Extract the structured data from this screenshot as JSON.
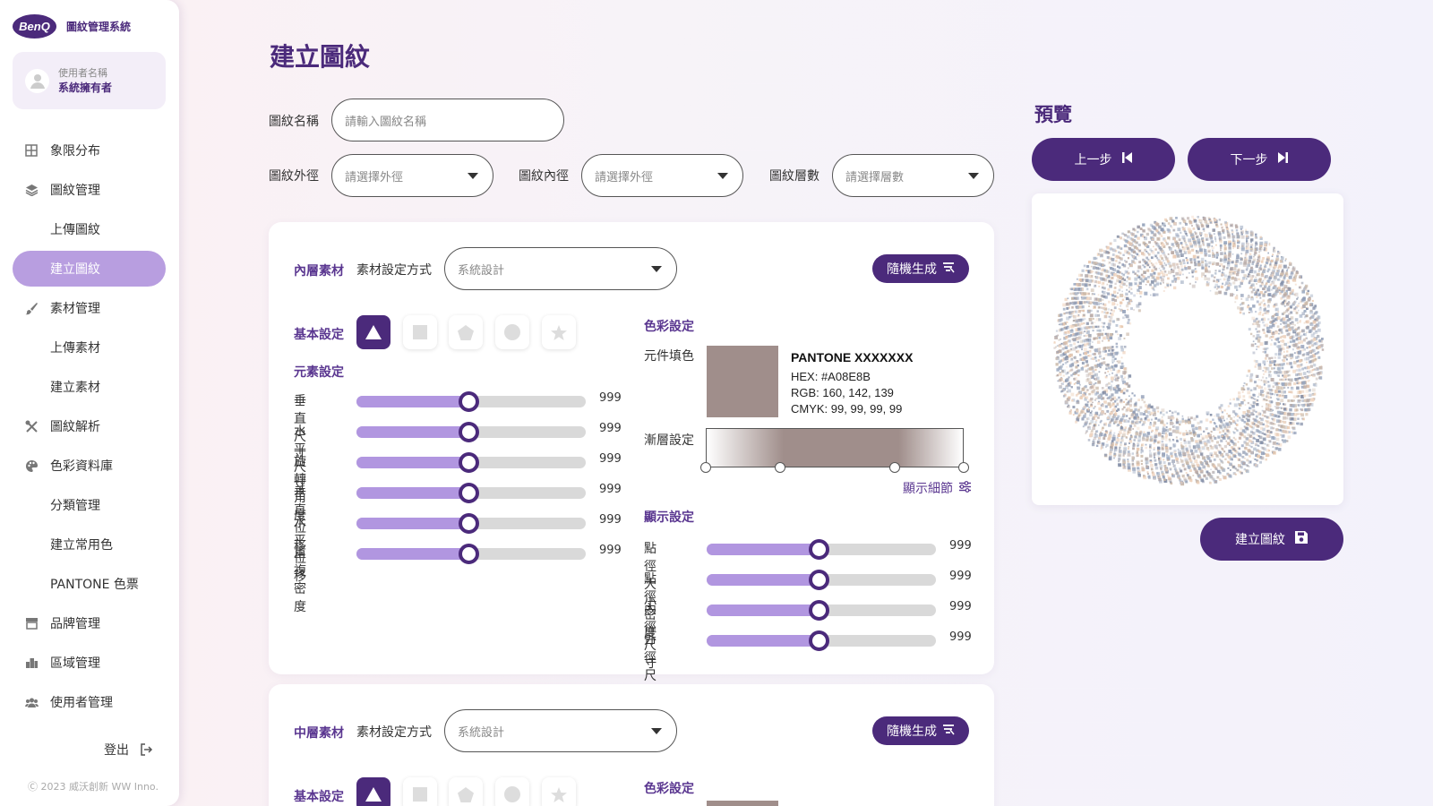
{
  "brand": {
    "logo_text": "BenQ",
    "app_name": "圖紋管理系統"
  },
  "user": {
    "name": "使用者名稱",
    "role": "系統擁有者"
  },
  "nav": [
    {
      "label": "象限分布",
      "icon": "grid-icon",
      "active": false
    },
    {
      "label": "圖紋管理",
      "icon": "layers-icon",
      "active": false
    },
    {
      "label": "上傳圖紋",
      "icon": "",
      "active": false
    },
    {
      "label": "建立圖紋",
      "icon": "",
      "active": true
    },
    {
      "label": "素材管理",
      "icon": "brush-icon",
      "active": false
    },
    {
      "label": "上傳素材",
      "icon": "",
      "active": false
    },
    {
      "label": "建立素材",
      "icon": "",
      "active": false
    },
    {
      "label": "圖紋解析",
      "icon": "tools-icon",
      "active": false
    },
    {
      "label": "色彩資料庫",
      "icon": "palette-icon",
      "active": false
    },
    {
      "label": "分類管理",
      "icon": "",
      "active": false
    },
    {
      "label": "建立常用色",
      "icon": "",
      "active": false
    },
    {
      "label": "PANTONE 色票",
      "icon": "",
      "active": false
    },
    {
      "label": "品牌管理",
      "icon": "store-icon",
      "active": false
    },
    {
      "label": "區域管理",
      "icon": "city-icon",
      "active": false
    },
    {
      "label": "使用者管理",
      "icon": "users-icon",
      "active": false
    }
  ],
  "logout": "登出",
  "copyright": "Ⓒ 2023 威沃創新 WW Inno.",
  "page": {
    "title": "建立圖紋",
    "name_label": "圖紋名稱",
    "name_placeholder": "請輸入圖紋名稱",
    "outer_label": "圖紋外徑",
    "outer_placeholder": "請選擇外徑",
    "inner_label": "圖紋內徑",
    "inner_placeholder": "請選擇外徑",
    "layers_label": "圖紋層數",
    "layers_placeholder": "請選擇層數"
  },
  "inner_layer": {
    "title": "內層素材",
    "method_label": "素材設定方式",
    "method_value": "系統設計",
    "random_button": "隨機生成",
    "basic_label": "基本設定",
    "shapes": [
      "triangle",
      "square",
      "pentagon",
      "circle",
      "star"
    ],
    "element_label": "元素設定",
    "element_sliders": [
      {
        "label": "垂直尺寸",
        "value": "999",
        "level": 0.49
      },
      {
        "label": "水平尺寸",
        "value": "999",
        "level": 0.49
      },
      {
        "label": "旋轉角度",
        "value": "999",
        "level": 0.49
      },
      {
        "label": "垂直位移",
        "value": "999",
        "level": 0.49
      },
      {
        "label": "水平位移",
        "value": "999",
        "level": 0.49
      },
      {
        "label": "重複密度",
        "value": "999",
        "level": 0.49
      }
    ],
    "color_label": "色彩設定",
    "fill_label": "元件填色",
    "swatch_color": "#A08E8B",
    "pantone": "PANTONE XXXXXXX",
    "hex": "HEX: #A08E8B",
    "rgb": "RGB: 160, 142, 139",
    "cmyk": "CMYK: 99, 99, 99, 99",
    "gradient_label": "漸層設定",
    "detail_link": "顯示細節",
    "display_label": "顯示設定",
    "display_sliders": [
      {
        "label": "點徑大小",
        "value": "999",
        "level": 0.49
      },
      {
        "label": "點徑密度",
        "value": "999",
        "level": 0.49
      },
      {
        "label": "內徑尺寸",
        "value": "999",
        "level": 0.49
      },
      {
        "label": "外徑尺寸",
        "value": "999",
        "level": 0.49
      }
    ]
  },
  "middle_layer": {
    "title": "中層素材",
    "method_label": "素材設定方式",
    "method_value": "系統設計",
    "random_button": "隨機生成",
    "basic_label": "基本設定",
    "color_label": "色彩設定"
  },
  "preview": {
    "title": "預覽",
    "prev_button": "上一步",
    "next_button": "下一步",
    "create_button": "建立圖紋"
  },
  "colors": {
    "primary": "#4B2A7B",
    "accent": "#B89EE0",
    "slider_fill": "#B196E0"
  }
}
